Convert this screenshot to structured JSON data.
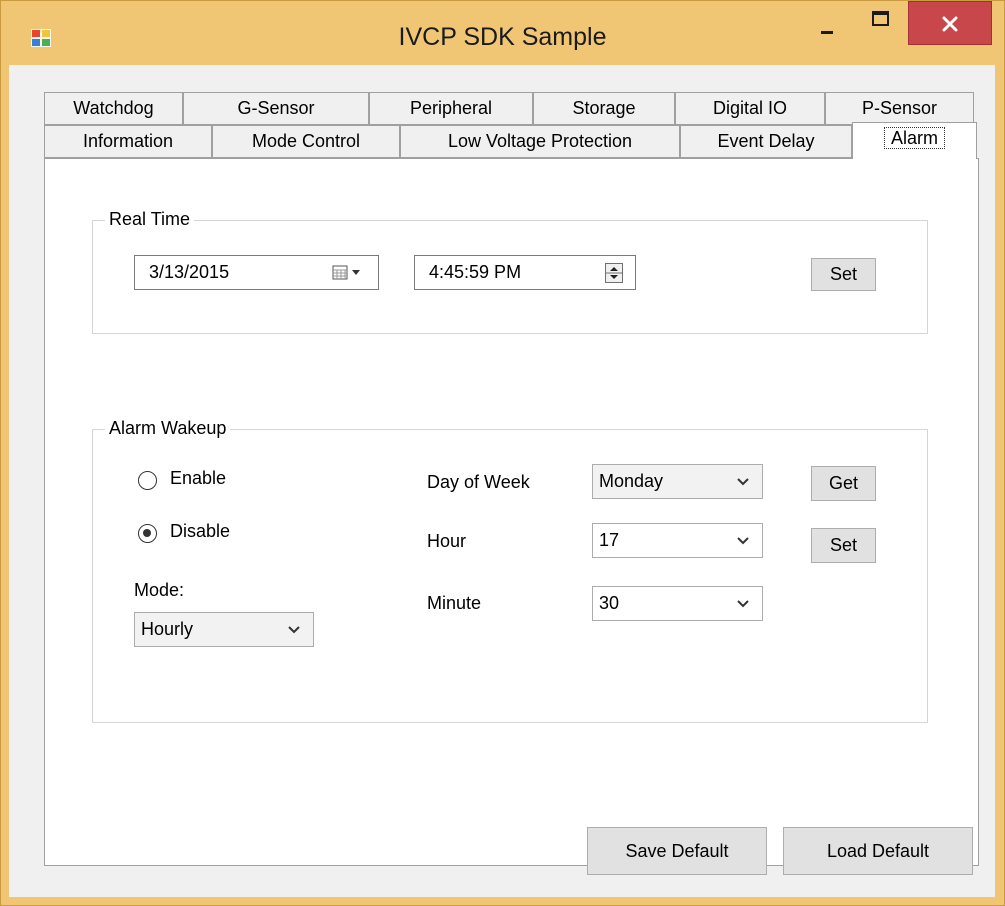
{
  "window": {
    "title": "IVCP SDK Sample",
    "colors": {
      "frame": "#f0c674",
      "close": "#c7474a"
    }
  },
  "tabs": {
    "row1": [
      "Watchdog",
      "G-Sensor",
      "Peripheral",
      "Storage",
      "Digital IO",
      "P-Sensor"
    ],
    "row2": [
      "Information",
      "Mode Control",
      "Low Voltage Protection",
      "Event Delay",
      "Alarm"
    ],
    "active": "Alarm"
  },
  "real_time": {
    "legend": "Real Time",
    "date": "3/13/2015",
    "time": "4:45:59 PM",
    "set_label": "Set"
  },
  "alarm_wakeup": {
    "legend": "Alarm Wakeup",
    "enable_label": "Enable",
    "disable_label": "Disable",
    "selected": "Disable",
    "mode_label": "Mode:",
    "mode_value": "Hourly",
    "day_label": "Day of Week",
    "day_value": "Monday",
    "hour_label": "Hour",
    "hour_value": "17",
    "minute_label": "Minute",
    "minute_value": "30",
    "get_label": "Get",
    "set_label": "Set"
  },
  "footer": {
    "save_label": "Save Default",
    "load_label": "Load Default"
  },
  "icons": [
    "app-icon",
    "minimize-icon",
    "maximize-icon",
    "close-icon",
    "calendar-icon",
    "chevron-down-icon",
    "spin-updown-icon"
  ]
}
